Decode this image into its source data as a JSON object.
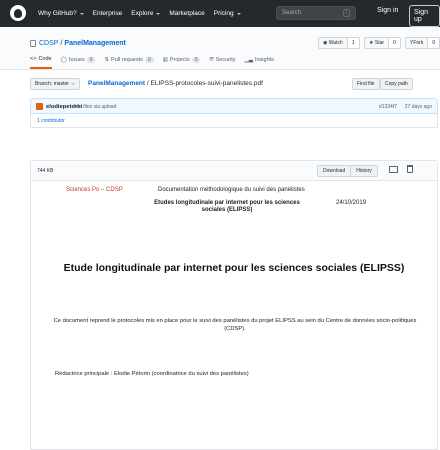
{
  "topbar": {
    "nav": [
      "Why GitHub?",
      "Enterprise",
      "Explore",
      "Marketplace",
      "Pricing"
    ],
    "search_placeholder": "Search",
    "search_shortcut": "/",
    "signin": "Sign in",
    "signup": "Sign up"
  },
  "repo": {
    "owner": "CDSP",
    "separator": "/",
    "name": "PanelManagement",
    "watch": {
      "label": "Watch",
      "count": "1"
    },
    "star": {
      "label": "Star",
      "count": "0"
    },
    "fork": {
      "label": "Fork",
      "count": "0"
    },
    "tabs": [
      {
        "label": "Code",
        "count": ""
      },
      {
        "label": "Issues",
        "count": "0"
      },
      {
        "label": "Pull requests",
        "count": "0"
      },
      {
        "label": "Projects",
        "count": "0"
      },
      {
        "label": "Security",
        "count": ""
      },
      {
        "label": "Insights",
        "count": ""
      }
    ]
  },
  "filenav": {
    "branch": "Branch: master",
    "crumb_repo": "PanelManagement",
    "crumb_sep": "/",
    "crumb_file": "ELIPSS-protocoles-suivi-panelistes.pdf",
    "find_file": "Find file",
    "copy_path": "Copy path"
  },
  "commit": {
    "author": "elodiepetorin",
    "message": "Add files via upload",
    "sha": "d1334f7",
    "when": "27 days ago",
    "contributors": "1 contributor"
  },
  "file": {
    "size": "744 KB",
    "download": "Download",
    "history": "History"
  },
  "document": {
    "header_left": "Sciences Po – CDSP",
    "header_right": "Documentation méthodologique du suivi des panélistes",
    "subtitle": "Etudes longitudinale par internet pour les sciences sociales (ELIPSS)",
    "date": "24/10/2019",
    "title": "Etude longitudinale par internet pour les sciences sociales (ELIPSS)",
    "paragraph": "Ce document reprend le protocoles mis en place pour le suivi des panélistes du projet ELIPSS au sein du Centre de données socio-politiques (CDSP).",
    "author_line": "Rédactrice principale : Elodie Pétorin (coordinatrice du suivi des panélistes)"
  }
}
